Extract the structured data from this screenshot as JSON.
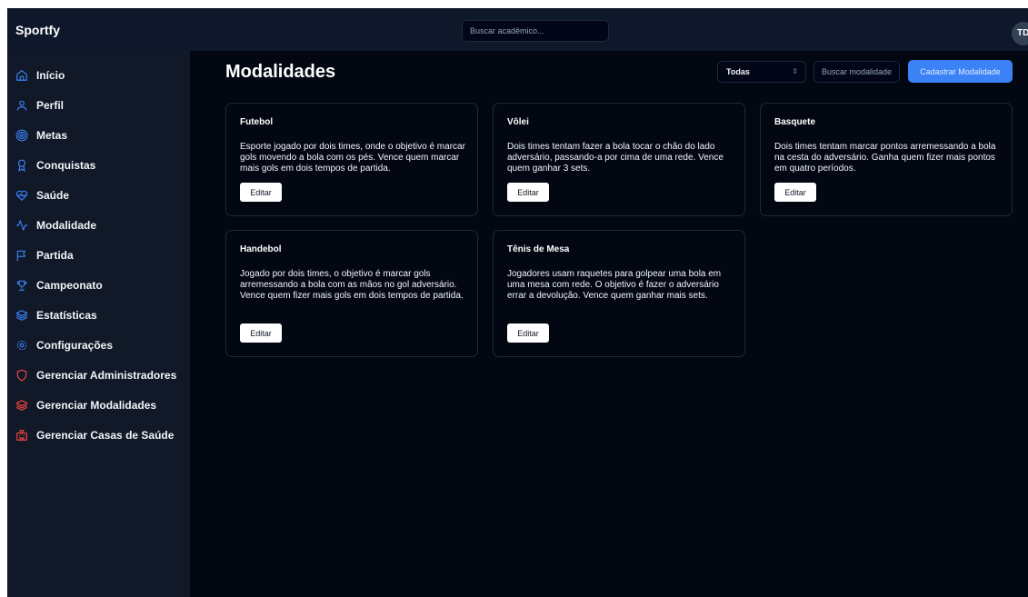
{
  "app": {
    "brand": "Sportfy"
  },
  "header": {
    "search_placeholder": "Buscar acadêmico...",
    "avatar_initials": "TD"
  },
  "colors": {
    "accent": "#3b82f6",
    "danger_icon": "#ef4444",
    "background": "#030712",
    "sidebar": "#111827"
  },
  "sidebar": {
    "items": [
      {
        "label": "Início",
        "icon": "home-icon"
      },
      {
        "label": "Perfil",
        "icon": "user-icon"
      },
      {
        "label": "Metas",
        "icon": "target-icon"
      },
      {
        "label": "Conquistas",
        "icon": "medal-icon"
      },
      {
        "label": "Saúde",
        "icon": "heart-pulse-icon"
      },
      {
        "label": "Modalidade",
        "icon": "activity-icon"
      },
      {
        "label": "Partida",
        "icon": "flag-icon"
      },
      {
        "label": "Campeonato",
        "icon": "trophy-icon"
      },
      {
        "label": "Estatísticas",
        "icon": "layers-icon"
      },
      {
        "label": "Configurações",
        "icon": "settings-icon"
      },
      {
        "label": "Gerenciar Administradores",
        "icon": "shield-icon"
      },
      {
        "label": "Gerenciar Modalidades",
        "icon": "layers-icon"
      },
      {
        "label": "Gerenciar Casas de Saúde",
        "icon": "hospital-icon"
      }
    ]
  },
  "main": {
    "title": "Modalidades",
    "filter": {
      "selected": "Todas"
    },
    "search_placeholder": "Buscar modalidade",
    "add_button": "Cadastrar Modalidade",
    "edit_label": "Editar",
    "cards": [
      {
        "title": "Futebol",
        "description": "Esporte jogado por dois times, onde o objetivo é marcar gols movendo a bola com os pés. Vence quem marcar mais gols em dois tempos de partida."
      },
      {
        "title": "Vôlei",
        "description": "Dois times tentam fazer a bola tocar o chão do lado adversário, passando-a por cima de uma rede. Vence quem ganhar 3 sets."
      },
      {
        "title": "Basquete",
        "description": "Dois times tentam marcar pontos arremessando a bola na cesta do adversário. Ganha quem fizer mais pontos em quatro períodos."
      },
      {
        "title": "Handebol",
        "description": "Jogado por dois times, o objetivo é marcar gols arremessando a bola com as mãos no gol adversário. Vence quem fizer mais gols em dois tempos de partida."
      },
      {
        "title": "Tênis de Mesa",
        "description": "Jogadores usam raquetes para golpear uma bola em uma mesa com rede. O objetivo é fazer o adversário errar a devolução. Vence quem ganhar mais sets."
      }
    ]
  }
}
